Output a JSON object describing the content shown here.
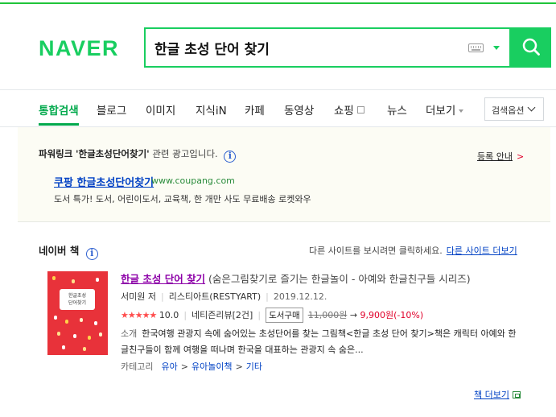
{
  "header": {
    "logo": "NAVER",
    "search_value": "한글 초성 단어 찾기"
  },
  "tabs": [
    {
      "label": "통합검색",
      "active": true
    },
    {
      "label": "블로그"
    },
    {
      "label": "이미지"
    },
    {
      "label": "지식iN"
    },
    {
      "label": "카페"
    },
    {
      "label": "동영상"
    },
    {
      "label": "쇼핑"
    },
    {
      "label": "뉴스"
    },
    {
      "label": "더보기"
    }
  ],
  "search_options": "검색옵션",
  "powerlink": {
    "title": "파워링크",
    "query": "'한글초성단어찾기'",
    "suffix": "관련 광고입니다.",
    "info_icon": "i",
    "register_guide": "등록 안내",
    "register_arrow": ">",
    "ad": {
      "title": "쿠팡 한글초성단어찾기",
      "url": "www.coupang.com",
      "description": "도서 특가! 도서, 어린이도서, 교육책, 한 개만 사도 무료배송 로켓와우"
    }
  },
  "book_section": {
    "title": "네이버 책",
    "info_icon": "i",
    "note": "다른 사이트를 보시려면 클릭하세요.",
    "other_sites_link": "다른 사이트 더보기",
    "more_books": "책 더보기",
    "book": {
      "cover_title_line1": "한글초성",
      "cover_title_line2": "단어찾기",
      "title_main": "한글 초성 단어 찾기",
      "title_rest": "(숨은그림찾기로 즐기는 한글놀이 - 아예와 한글친구들 시리즈)",
      "author": "서미원 저",
      "publisher": "리스티아트(RESTYART)",
      "date": "2019.12.12.",
      "stars": "★★★★★",
      "rating": "10.0",
      "reviews": "네티즌리뷰[2건]",
      "buy_label": "도서구매",
      "old_price": "11,000원",
      "price_arrow": "→",
      "new_price": "9,900원(-10%)",
      "desc_label": "소개",
      "description": "한국여행 관광지 속에 숨어있는 초성단어를 찾는 그림책<한글 초성 단어 찾기>책은 캐릭터 아예와 한글친구들이 함께 여행을 떠나며 한국을 대표하는 관광지 속 숨은...",
      "category_label": "카테고리",
      "categories": [
        "유아",
        "유아놀이책",
        "기타"
      ],
      "category_sep": ">"
    }
  }
}
